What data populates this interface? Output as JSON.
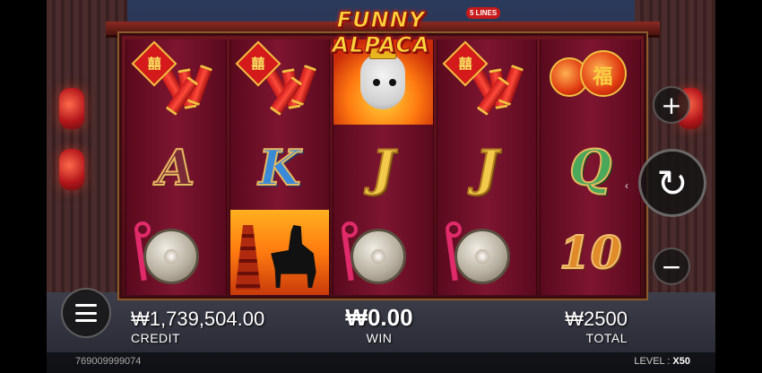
{
  "game": {
    "logo": "FUNNY ALPACA",
    "lines_badge": "5 LINES"
  },
  "reels": [
    [
      {
        "symbol": "firecracker"
      },
      {
        "symbol": "A"
      },
      {
        "symbol": "gong"
      }
    ],
    [
      {
        "symbol": "firecracker"
      },
      {
        "symbol": "K"
      },
      {
        "symbol": "pagoda-alpaca"
      }
    ],
    [
      {
        "symbol": "alpaca"
      },
      {
        "symbol": "J"
      },
      {
        "symbol": "gong"
      }
    ],
    [
      {
        "symbol": "firecracker"
      },
      {
        "symbol": "J"
      },
      {
        "symbol": "gong"
      }
    ],
    [
      {
        "symbol": "lanterns"
      },
      {
        "symbol": "Q"
      },
      {
        "symbol": "10"
      }
    ]
  ],
  "symbol_text": {
    "A": "A",
    "K": "K",
    "J": "J",
    "Q": "Q",
    "ten": "10",
    "firecracker_char": "囍",
    "lantern_char": "福"
  },
  "controls": {
    "plus": "+",
    "minus": "−",
    "spin": "↻",
    "spin_hint": "‹"
  },
  "info": {
    "credit_value": "₩1,739,504.00",
    "credit_label": "CREDIT",
    "win_value": "₩0.00",
    "win_label": "WIN",
    "total_value": "₩2500",
    "total_label": "TOTAL"
  },
  "footer": {
    "id": "769009999074",
    "level_label": "LEVEL :",
    "level_value": "X50"
  }
}
